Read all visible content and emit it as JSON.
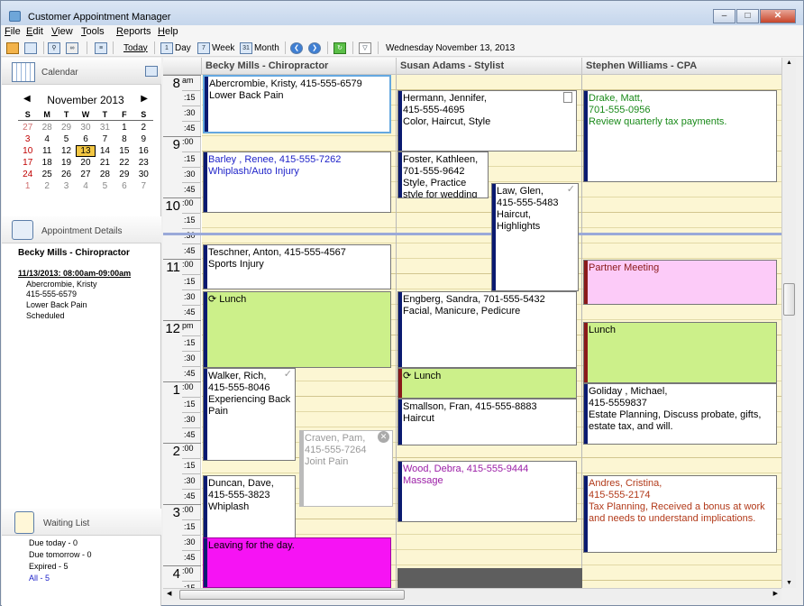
{
  "window": {
    "title": "Customer Appointment Manager"
  },
  "menu": [
    "File",
    "Edit",
    "View",
    "Tools",
    "Reports",
    "Help"
  ],
  "toolbar": {
    "today": "Today",
    "day": "Day",
    "week": "Week",
    "month": "Month",
    "date_label": "Wednesday November 13, 2013"
  },
  "left": {
    "calendar_header": "Calendar",
    "month_label": "November  2013",
    "dow": [
      "S",
      "M",
      "T",
      "W",
      "T",
      "F",
      "S"
    ],
    "weeks": [
      [
        "27",
        "28",
        "29",
        "30",
        "31",
        "1",
        "2"
      ],
      [
        "3",
        "4",
        "5",
        "6",
        "7",
        "8",
        "9"
      ],
      [
        "10",
        "11",
        "12",
        "13",
        "14",
        "15",
        "16"
      ],
      [
        "17",
        "18",
        "19",
        "20",
        "21",
        "22",
        "23"
      ],
      [
        "24",
        "25",
        "26",
        "27",
        "28",
        "29",
        "30"
      ],
      [
        "1",
        "2",
        "3",
        "4",
        "5",
        "6",
        "7"
      ]
    ],
    "details_header": "Appointment Details",
    "details_name": "Becky Mills - Chiropractor",
    "details_when": "11/13/2013: 08:00am-09:00am",
    "details_lines": [
      "Abercrombie, Kristy",
      "415-555-6579",
      "Lower Back Pain",
      "Scheduled"
    ],
    "waiting_header": "Waiting List",
    "waiting": [
      "Due today - 0",
      "Due tomorrow - 0",
      "Expired - 5",
      "All - 5"
    ]
  },
  "columns": [
    "Becky Mills - Chiropractor",
    "Susan Adams - Stylist",
    "Stephen Williams - CPA"
  ],
  "times": {
    "hours": [
      "8",
      "9",
      "10",
      "11",
      "12",
      "1",
      "2",
      "3",
      "4"
    ],
    "ampm": {
      "am": "am",
      "pm": "pm"
    },
    "mins": [
      ":15",
      ":30",
      ":45"
    ],
    "zero": ":00"
  },
  "appointments": {
    "a1": [
      "Abercrombie, Kristy, 415-555-6579",
      "Lower Back Pain"
    ],
    "a2": [
      "Barley , Renee, 415-555-7262",
      "Whiplash/Auto Injury"
    ],
    "a3": [
      "Teschner, Anton, 415-555-4567",
      "Sports Injury"
    ],
    "a4": [
      "Lunch"
    ],
    "a5": [
      "Walker, Rich,",
      "415-555-8046",
      "Experiencing Back",
      "Pain"
    ],
    "a6": [
      "Craven, Pam,",
      "415-555-7264",
      "Joint Pain"
    ],
    "a7": [
      "Duncan, Dave,",
      "415-555-3823",
      "Whiplash"
    ],
    "a8": [
      "Leaving for the day."
    ],
    "b1": [
      "Hermann, Jennifer,",
      "415-555-4695",
      "Color, Haircut, Style"
    ],
    "b2": [
      "Foster, Kathleen,",
      "701-555-9642",
      "Style, Practice",
      "style for wedding"
    ],
    "b3": [
      "Law, Glen,",
      "415-555-5483",
      "Haircut, Highlights"
    ],
    "b4": [
      "Engberg, Sandra, 701-555-5432",
      "Facial, Manicure, Pedicure"
    ],
    "b5": [
      "Lunch"
    ],
    "b6": [
      "Smallson, Fran, 415-555-8883",
      "Haircut"
    ],
    "b7": [
      "Wood, Debra, 415-555-9444",
      "Massage"
    ],
    "c1": [
      "Drake, Matt,",
      "701-555-0956",
      "Review quarterly tax payments."
    ],
    "c2": [
      "Partner Meeting"
    ],
    "c3": [
      "Lunch"
    ],
    "c4": [
      "Goliday , Michael,",
      "415-5559837",
      "Estate Planning, Discuss probate, gifts,",
      "estate tax, and will."
    ],
    "c5": [
      "Andres, Cristina,",
      "415-555-2174",
      "Tax Planning, Received a bonus at work",
      "and needs to understand implications."
    ]
  },
  "colors": {
    "grid_bg": "#fcf6d3",
    "lunch": "#ccf08a",
    "partner": "#fccbf8",
    "leaving": "#f613f4",
    "blue_text": "#1f23c9",
    "green_text": "#1a8a1a",
    "purple_text": "#9b1da6",
    "red_text": "#b23a1a"
  }
}
